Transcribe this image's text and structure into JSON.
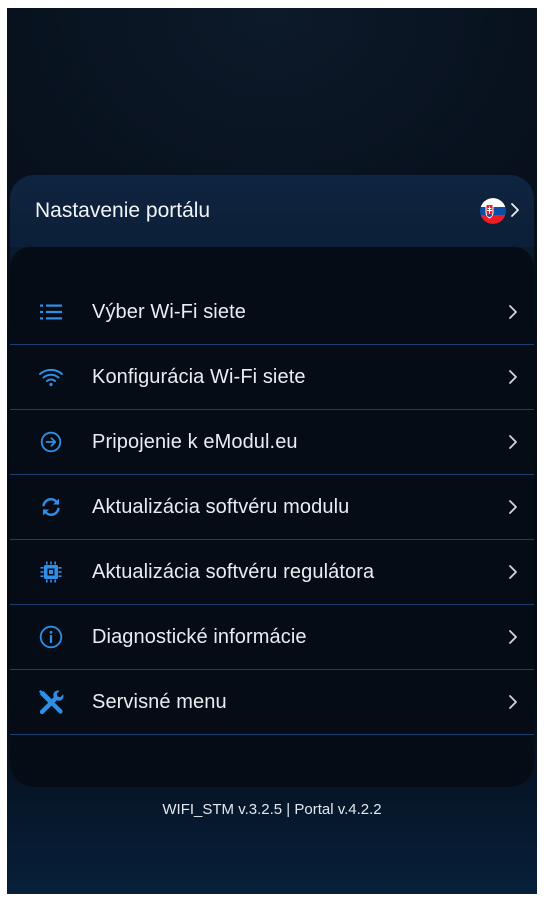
{
  "header": {
    "title": "Nastavenie portálu",
    "language_flag_icon": "slovakia-flag-icon"
  },
  "menu": {
    "items": [
      {
        "label": "Výber Wi-Fi siete",
        "icon": "list-icon"
      },
      {
        "label": "Konfigurácia Wi-Fi siete",
        "icon": "wifi-icon"
      },
      {
        "label": "Pripojenie k eModul.eu",
        "icon": "arrow-circle-right-icon"
      },
      {
        "label": "Aktualizácia softvéru modulu",
        "icon": "refresh-icon"
      },
      {
        "label": "Aktualizácia softvéru regulátora",
        "icon": "chip-icon"
      },
      {
        "label": "Diagnostické informácie",
        "icon": "info-icon"
      },
      {
        "label": "Servisné menu",
        "icon": "tools-icon"
      }
    ]
  },
  "footer": {
    "version_text": "WIFI_STM v.3.2.5 | Portal v.4.2.2"
  },
  "colors": {
    "icon_blue": "#2f8fe6",
    "divider": "#1c3f6e",
    "text": "#e9edf2"
  }
}
